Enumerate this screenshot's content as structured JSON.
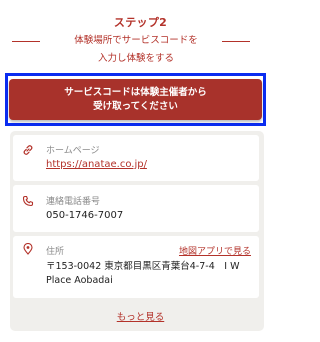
{
  "step": {
    "title": "ステップ2",
    "instruction_line1": "体験場所でサービスコードを",
    "instruction_line2": "入力し体験をする"
  },
  "cta": {
    "line1": "サービスコードは体験主催者から",
    "line2": "受け取ってください"
  },
  "info": {
    "homepage": {
      "label": "ホームページ",
      "url": "https://anatae.co.jp/",
      "icon": "link-icon"
    },
    "phone": {
      "label": "連絡電話番号",
      "value": "050-1746-7007",
      "icon": "phone-icon"
    },
    "address": {
      "label": "住所",
      "map_link": "地図アプリで見る",
      "line1": "〒153-0042 東京都目黒区青葉台4-7-4　I W",
      "line2": "Place Aobadai",
      "icon": "location-pin-icon"
    }
  },
  "more": {
    "label": "もっと見る"
  },
  "colors": {
    "accent": "#b3322a",
    "cta": "#a8322b",
    "highlight": "#0a2cf0",
    "panel": "#f0efec"
  }
}
